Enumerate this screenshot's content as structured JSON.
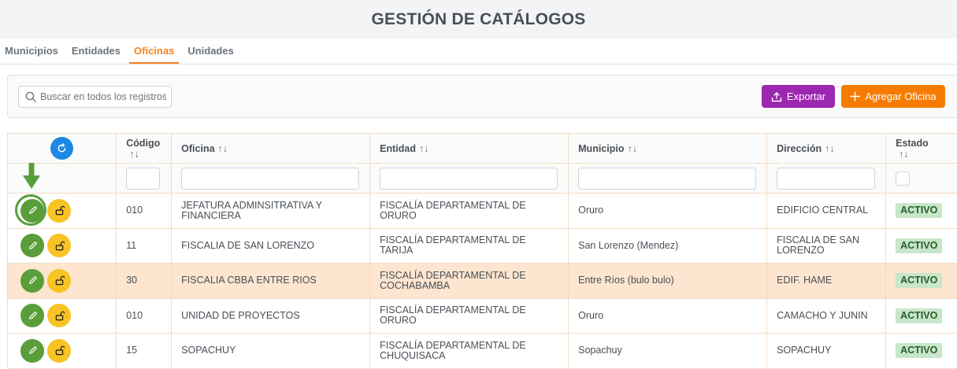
{
  "page": {
    "title": "GESTIÓN DE CATÁLOGOS"
  },
  "tabs": [
    {
      "label": "Municipios"
    },
    {
      "label": "Entidades"
    },
    {
      "label": "Oficinas"
    },
    {
      "label": "Unidades"
    }
  ],
  "active_tab": "Oficinas",
  "search": {
    "placeholder": "Buscar en todos los registros",
    "value": ""
  },
  "toolbar": {
    "export_label": "Exportar",
    "add_label": "Agregar Oficina"
  },
  "colors": {
    "accent": "#f58220",
    "export": "#9c27b0",
    "add": "#f57c00",
    "edit": "#5a9e3a",
    "unlock": "#f7c325",
    "refresh": "#1e88e5",
    "active_badge_bg": "#c8e6c9"
  },
  "table": {
    "columns": {
      "codigo": "Código",
      "oficina": "Oficina",
      "entidad": "Entidad",
      "municipio": "Municipio",
      "direccion": "Dirección",
      "estado": "Estado"
    },
    "sort_icon": "↑↓",
    "rows": [
      {
        "codigo": "010",
        "oficina": "JEFATURA ADMINSITRATIVA Y FINANCIERA",
        "entidad": "FISCALÍA DEPARTAMENTAL DE ORURO",
        "municipio": "Oruro",
        "direccion": "EDIFICIO CENTRAL",
        "estado": "ACTIVO"
      },
      {
        "codigo": "11",
        "oficina": "FISCALIA DE SAN LORENZO",
        "entidad": "FISCALÍA DEPARTAMENTAL DE TARIJA",
        "municipio": "San Lorenzo (Mendez)",
        "direccion": "FISCALIA DE SAN LORENZO",
        "estado": "ACTIVO"
      },
      {
        "codigo": "30",
        "oficina": "FISCALIA CBBA ENTRE RIOS",
        "entidad": "FISCALÍA DEPARTAMENTAL DE COCHABAMBA",
        "municipio": "Entre Ríos (bulo bulo)",
        "direccion": "EDIF. HAME",
        "estado": "ACTIVO"
      },
      {
        "codigo": "010",
        "oficina": "UNIDAD DE PROYECTOS",
        "entidad": "FISCALÍA DEPARTAMENTAL DE ORURO",
        "municipio": "Oruro",
        "direccion": "CAMACHO Y JUNIN",
        "estado": "ACTIVO"
      },
      {
        "codigo": "15",
        "oficina": "SOPACHUY",
        "entidad": "FISCALÍA DEPARTAMENTAL DE CHUQUISACA",
        "municipio": "Sopachuy",
        "direccion": "SOPACHUY",
        "estado": "ACTIVO"
      }
    ]
  }
}
